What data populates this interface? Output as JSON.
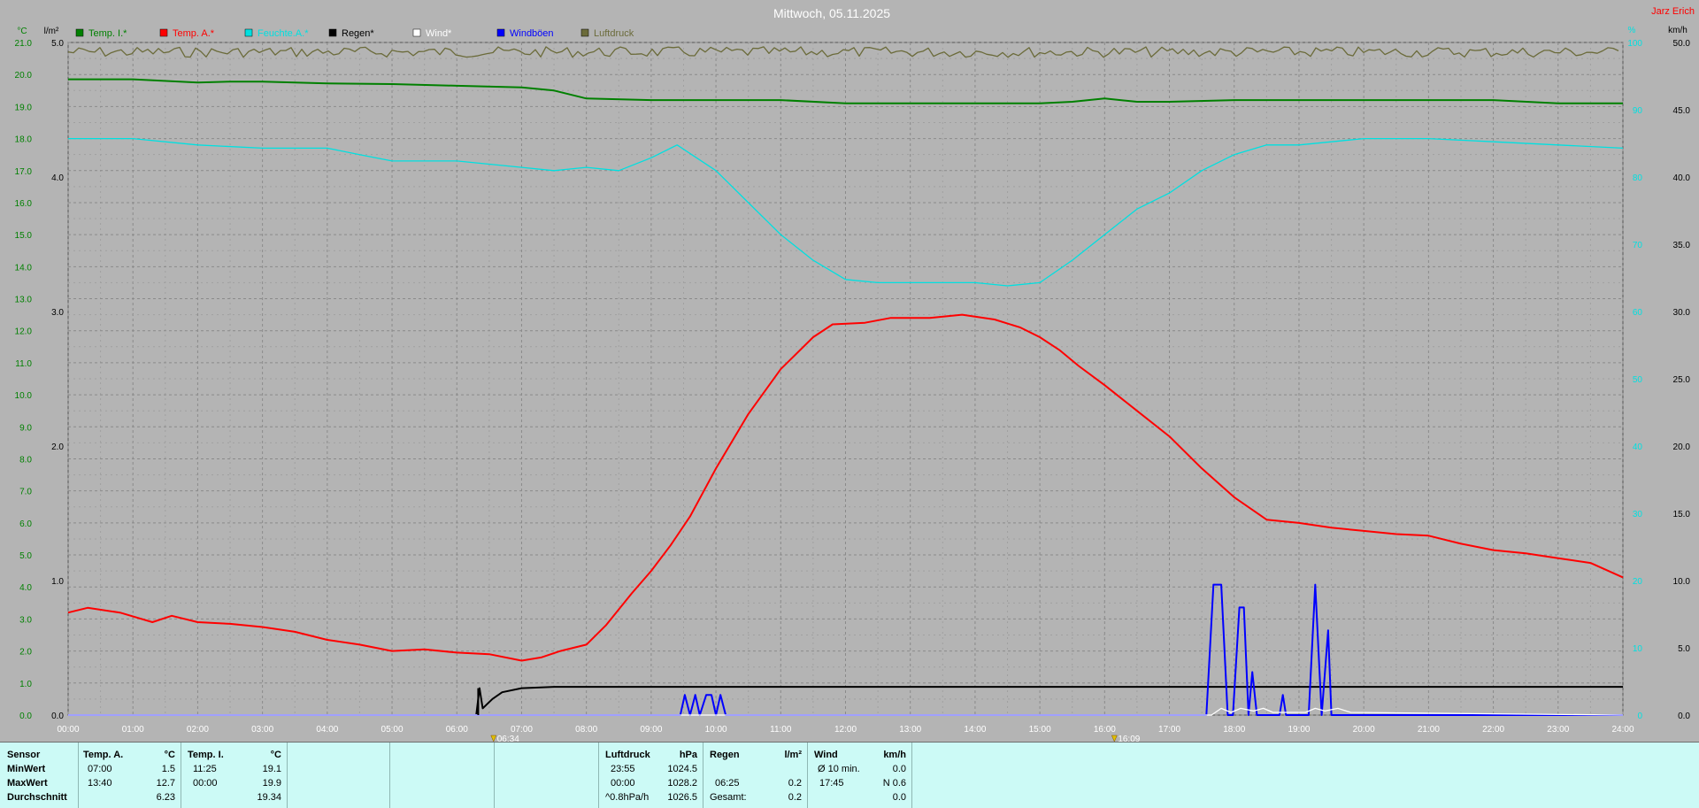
{
  "header": {
    "title": "Mittwoch, 05.11.2025",
    "author": "Jarz Erich"
  },
  "colors": {
    "temp_inside": "#008000",
    "temp_outside": "#ff0000",
    "humidity": "#00e0e0",
    "rain": "#000000",
    "wind": "#ffffff",
    "gusts": "#0000ff",
    "pressure": "#6b6b3a"
  },
  "chart_data": {
    "type": "line",
    "title": "Mittwoch, 05.11.2025",
    "grid": true,
    "legend_position": "top",
    "axis_units": {
      "temp": "°C",
      "rain": "l/m²",
      "humidity": "%",
      "wind": "km/h"
    },
    "x_range_hours": [
      0,
      24
    ],
    "x_tick_labels": [
      "00:00",
      "01:00",
      "02:00",
      "03:00",
      "04:00",
      "05:00",
      "06:00",
      "07:00",
      "08:00",
      "09:00",
      "10:00",
      "11:00",
      "12:00",
      "13:00",
      "14:00",
      "15:00",
      "16:00",
      "17:00",
      "18:00",
      "19:00",
      "20:00",
      "21:00",
      "22:00",
      "23:00",
      "24:00"
    ],
    "y_temp_range": [
      0,
      21
    ],
    "y_temp_ticks": [
      "0.0",
      "1.0",
      "2.0",
      "3.0",
      "4.0",
      "5.0",
      "6.0",
      "7.0",
      "8.0",
      "9.0",
      "10.0",
      "11.0",
      "12.0",
      "13.0",
      "14.0",
      "15.0",
      "16.0",
      "17.0",
      "18.0",
      "19.0",
      "20.0",
      "21.0"
    ],
    "y_rain_range": [
      0,
      5
    ],
    "y_rain_ticks": [
      "0.0",
      "1.0",
      "2.0",
      "3.0",
      "4.0",
      "5.0"
    ],
    "y_wind_range": [
      0,
      50
    ],
    "y_wind_ticks": [
      "0.0",
      "5.0",
      "10.0",
      "15.0",
      "20.0",
      "25.0",
      "30.0",
      "35.0",
      "40.0",
      "45.0",
      "50.0"
    ],
    "y_humidity_ticks": [
      "0",
      "10",
      "20",
      "30",
      "40",
      "50",
      "60",
      "70",
      "80",
      "90",
      "100"
    ],
    "markers": [
      {
        "label": "06:34",
        "hour": 6.567
      },
      {
        "label": "16:09",
        "hour": 16.15
      }
    ],
    "series": [
      {
        "name": "Temp. I.*",
        "key": "temp_inside",
        "axis": "temp",
        "x": [
          0,
          1,
          2,
          2.5,
          3,
          4,
          5,
          6,
          7,
          7.5,
          8,
          9,
          10,
          11,
          12,
          13,
          14,
          15,
          15.5,
          16,
          16.5,
          17,
          18,
          19,
          20,
          21,
          22,
          23,
          24
        ],
        "y": [
          19.85,
          19.85,
          19.75,
          19.78,
          19.78,
          19.72,
          19.7,
          19.65,
          19.6,
          19.5,
          19.25,
          19.2,
          19.2,
          19.2,
          19.1,
          19.1,
          19.1,
          19.1,
          19.15,
          19.25,
          19.15,
          19.15,
          19.2,
          19.2,
          19.2,
          19.2,
          19.2,
          19.1,
          19.1
        ]
      },
      {
        "name": "Temp. A.*",
        "key": "temp_outside",
        "axis": "temp",
        "x": [
          0,
          0.3,
          0.8,
          1.3,
          1.6,
          2,
          2.5,
          3,
          3.5,
          4,
          4.5,
          5,
          5.5,
          6,
          6.5,
          7,
          7.3,
          7.6,
          8,
          8.3,
          8.7,
          9,
          9.3,
          9.6,
          10,
          10.5,
          11,
          11.5,
          11.8,
          12.3,
          12.7,
          13.3,
          13.8,
          14.3,
          14.7,
          15,
          15.3,
          15.6,
          16,
          16.5,
          17,
          17.5,
          18,
          18.5,
          19,
          19.5,
          20,
          20.5,
          21,
          21.5,
          22,
          22.5,
          23,
          23.5,
          24
        ],
        "y": [
          3.2,
          3.35,
          3.2,
          2.9,
          3.1,
          2.9,
          2.85,
          2.75,
          2.6,
          2.35,
          2.2,
          2.0,
          2.05,
          1.95,
          1.9,
          1.7,
          1.8,
          2.0,
          2.2,
          2.8,
          3.8,
          4.5,
          5.3,
          6.2,
          7.7,
          9.4,
          10.8,
          11.8,
          12.2,
          12.25,
          12.4,
          12.4,
          12.5,
          12.35,
          12.1,
          11.8,
          11.4,
          10.9,
          10.3,
          9.5,
          8.7,
          7.7,
          6.8,
          6.1,
          6.0,
          5.85,
          5.75,
          5.65,
          5.6,
          5.35,
          5.15,
          5.05,
          4.9,
          4.75,
          4.3
        ]
      },
      {
        "name": "Feuchte.A.*",
        "key": "humidity",
        "axis": "temp",
        "x": [
          0,
          1,
          2,
          3,
          4,
          4.5,
          5,
          6,
          7,
          7.5,
          8,
          8.5,
          9,
          9.4,
          10,
          10.5,
          11,
          11.5,
          12,
          12.5,
          13,
          13.5,
          14,
          14.5,
          15,
          15.5,
          16,
          16.5,
          17,
          17.5,
          18,
          18.5,
          19,
          20,
          21,
          22,
          23,
          24
        ],
        "y": [
          18.0,
          18.0,
          17.8,
          17.7,
          17.7,
          17.5,
          17.3,
          17.3,
          17.1,
          17.0,
          17.1,
          17.0,
          17.4,
          17.8,
          17.0,
          16.0,
          15.0,
          14.2,
          13.6,
          13.5,
          13.5,
          13.5,
          13.5,
          13.4,
          13.5,
          14.2,
          15.0,
          15.8,
          16.3,
          17.0,
          17.5,
          17.8,
          17.8,
          18.0,
          18.0,
          17.9,
          17.8,
          17.7
        ]
      },
      {
        "name": "Regen*",
        "key": "rain",
        "axis": "rain",
        "x": [
          0,
          6.3,
          6.35,
          6.4,
          6.55,
          6.7,
          7.0,
          7.5,
          8,
          24
        ],
        "y": [
          0,
          0,
          0.2,
          0.05,
          0.12,
          0.17,
          0.2,
          0.21,
          0.21,
          0.21
        ]
      },
      {
        "name": "Wind*",
        "key": "wind",
        "axis": "wind",
        "x": [
          0,
          17.65,
          17.8,
          17.95,
          18.1,
          18.3,
          18.45,
          18.6,
          19.1,
          19.25,
          19.4,
          19.6,
          19.8,
          24
        ],
        "y": [
          0,
          0,
          0.5,
          0.2,
          0.5,
          0.3,
          0.5,
          0.2,
          0.2,
          0.5,
          0.3,
          0.5,
          0.2,
          0
        ]
      },
      {
        "name": "Windböen",
        "key": "gusts",
        "axis": "wind",
        "x": [
          0,
          9.45,
          9.52,
          9.6,
          9.68,
          9.75,
          9.85,
          9.93,
          10.0,
          10.07,
          10.15,
          10.23,
          10.3,
          17.57,
          17.68,
          17.8,
          17.9,
          17.98,
          18.08,
          18.15,
          18.22,
          18.28,
          18.35,
          18.5,
          18.7,
          18.75,
          18.8,
          19.15,
          19.25,
          19.35,
          19.45,
          19.5,
          19.58,
          24
        ],
        "y": [
          0,
          0,
          1.5,
          0,
          1.5,
          0,
          1.5,
          1.5,
          0,
          1.5,
          0,
          0,
          0,
          0,
          9.7,
          9.7,
          0,
          0,
          8.0,
          8.0,
          0,
          3.2,
          0,
          0,
          0,
          1.5,
          0,
          0,
          9.7,
          0,
          6.3,
          0,
          0,
          0
        ]
      },
      {
        "name": "Luftdruck",
        "key": "pressure",
        "axis": "top",
        "x": [
          0,
          24
        ],
        "y": [
          20.7,
          20.7
        ]
      }
    ]
  },
  "stats": {
    "sensor_label": "Sensor",
    "min_label": "MinWert",
    "max_label": "MaxWert",
    "avg_label": "Durchschnitt",
    "temp_a": {
      "header": "Temp. A.",
      "unit": "°C",
      "min_time": "07:00",
      "min_val": "1.5",
      "max_time": "13:40",
      "max_val": "12.7",
      "avg": "6.23"
    },
    "temp_i": {
      "header": "Temp. I.",
      "unit": "°C",
      "min_time": "11:25",
      "min_val": "19.1",
      "max_time": "00:00",
      "max_val": "19.9",
      "avg": "19.34"
    },
    "pressure": {
      "header": "Luftdruck",
      "unit": "hPa",
      "r1_time": "23:55",
      "r1_val": "1024.5",
      "r2_time": "00:00",
      "r2_val": "1028.2",
      "r3_label": "^0.8hPa/h",
      "r3_val": "1026.5"
    },
    "rain": {
      "header": "Regen",
      "unit": "l/m²",
      "r2_time": "06:25",
      "r2_val": "0.2",
      "r3_label": "Gesamt:",
      "r3_val": "0.2"
    },
    "wind": {
      "header": "Wind",
      "unit": "km/h",
      "r1_label": "Ø 10 min.",
      "r1_val": "0.0",
      "r2_time": "17:45",
      "r2_val": "N 0.6",
      "r3_val": "0.0"
    }
  }
}
